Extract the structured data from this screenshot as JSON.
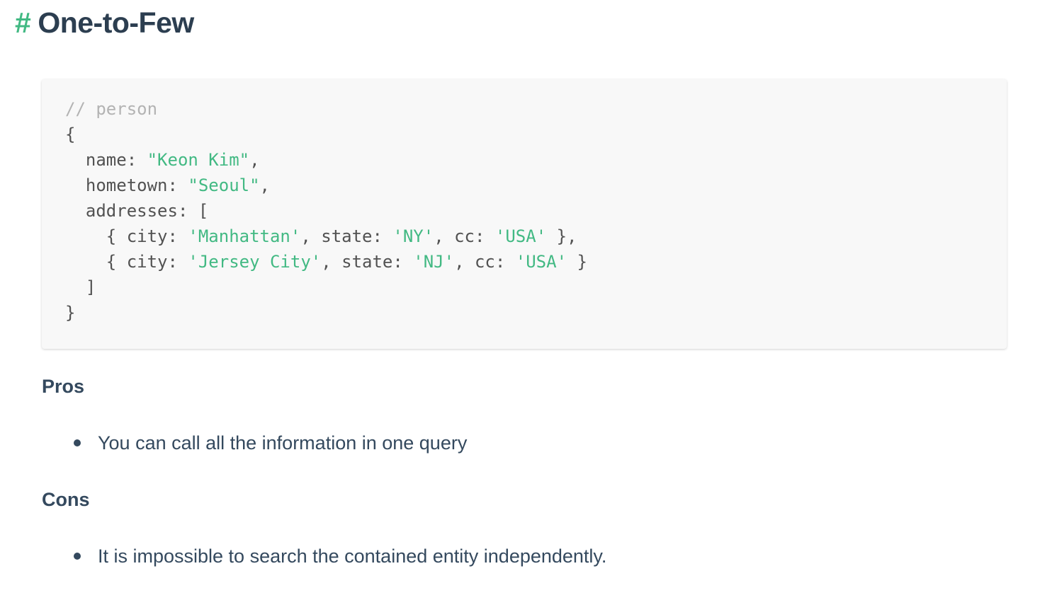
{
  "heading": {
    "anchor": "#",
    "title": "One-to-Few"
  },
  "code": {
    "lines": [
      [
        {
          "t": "comment",
          "v": "// person"
        }
      ],
      [
        {
          "t": "plain",
          "v": "{"
        }
      ],
      [
        {
          "t": "plain",
          "v": "  name: "
        },
        {
          "t": "string",
          "v": "\"Keon Kim\""
        },
        {
          "t": "plain",
          "v": ","
        }
      ],
      [
        {
          "t": "plain",
          "v": "  hometown: "
        },
        {
          "t": "string",
          "v": "\"Seoul\""
        },
        {
          "t": "plain",
          "v": ","
        }
      ],
      [
        {
          "t": "plain",
          "v": "  addresses: ["
        }
      ],
      [
        {
          "t": "plain",
          "v": "    { city: "
        },
        {
          "t": "string",
          "v": "'Manhattan'"
        },
        {
          "t": "plain",
          "v": ", state: "
        },
        {
          "t": "string",
          "v": "'NY'"
        },
        {
          "t": "plain",
          "v": ", cc: "
        },
        {
          "t": "string",
          "v": "'USA'"
        },
        {
          "t": "plain",
          "v": " },"
        }
      ],
      [
        {
          "t": "plain",
          "v": "    { city: "
        },
        {
          "t": "string",
          "v": "'Jersey City'"
        },
        {
          "t": "plain",
          "v": ", state: "
        },
        {
          "t": "string",
          "v": "'NJ'"
        },
        {
          "t": "plain",
          "v": ", cc: "
        },
        {
          "t": "string",
          "v": "'USA'"
        },
        {
          "t": "plain",
          "v": " }"
        }
      ],
      [
        {
          "t": "plain",
          "v": "  ]"
        }
      ],
      [
        {
          "t": "plain",
          "v": "}"
        }
      ]
    ]
  },
  "pros": {
    "title": "Pros",
    "items": [
      "You can call all the information in one query"
    ]
  },
  "cons": {
    "title": "Cons",
    "items": [
      "It is impossible to search the contained entity independently."
    ]
  },
  "colors": {
    "accent": "#42b983",
    "text": "#34495e",
    "heading": "#2c3e50",
    "code_bg": "#f8f8f8",
    "comment": "#b3b3b3"
  }
}
